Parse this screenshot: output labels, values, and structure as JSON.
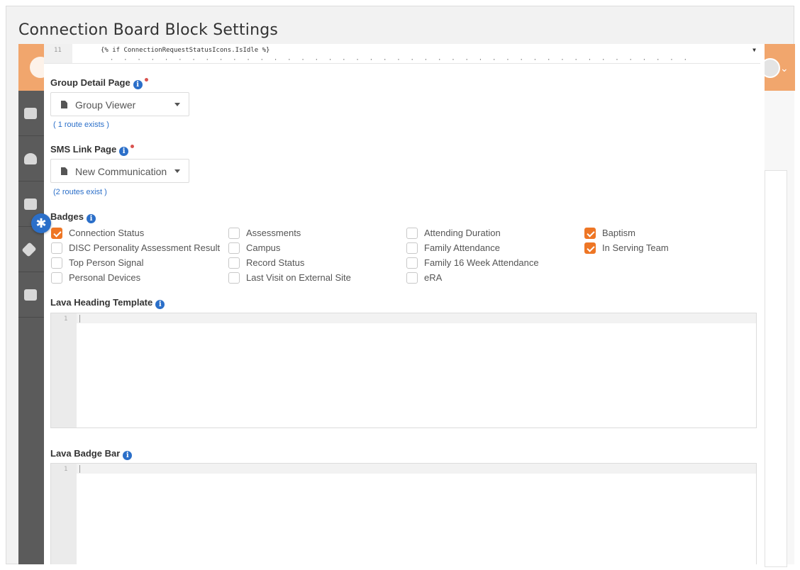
{
  "page": {
    "title": "Connection Board Block Settings"
  },
  "code_preview": {
    "line_number": "11",
    "line_text": "{% if ConnectionRequestStatusIcons.IsIdle %}",
    "line_text_2": "  ·  ·  ·  ·  ·  ·  ·  ·  ·  ·  ·  ·  ·  ·  ·  ·  ·  ·  ·  ·  ·  ·  ·  ·  ·  ·  ·  ·  ·  ·  ·  ·  ·  ·  ·  ·  ·  ·  ·  ·  ·  ·  ·"
  },
  "group_detail": {
    "label": "Group Detail Page",
    "selected": "Group Viewer",
    "routes": "( 1 route exists )"
  },
  "sms_link": {
    "label": "SMS Link Page",
    "selected": "New Communication",
    "routes": "(2 routes exist )"
  },
  "badges": {
    "label": "Badges",
    "items": [
      {
        "label": "Connection Status",
        "checked": true
      },
      {
        "label": "DISC Personality Assessment Result",
        "checked": false
      },
      {
        "label": "Top Person Signal",
        "checked": false
      },
      {
        "label": "Personal Devices",
        "checked": false
      },
      {
        "label": "Assessments",
        "checked": false
      },
      {
        "label": "Campus",
        "checked": false
      },
      {
        "label": "Record Status",
        "checked": false
      },
      {
        "label": "Last Visit on External Site",
        "checked": false
      },
      {
        "label": "Attending Duration",
        "checked": false
      },
      {
        "label": "Family Attendance",
        "checked": false
      },
      {
        "label": "Family 16 Week Attendance",
        "checked": false
      },
      {
        "label": "eRA",
        "checked": false
      },
      {
        "label": "Baptism",
        "checked": true
      },
      {
        "label": "In Serving Team",
        "checked": true
      }
    ]
  },
  "lava_heading": {
    "label": "Lava Heading Template",
    "line_number": "1"
  },
  "lava_badge_bar": {
    "label": "Lava Badge Bar",
    "line_number": "1"
  },
  "colors": {
    "accent": "#ee7625",
    "info": "#2b6fc9",
    "header": "#f1a66d"
  }
}
